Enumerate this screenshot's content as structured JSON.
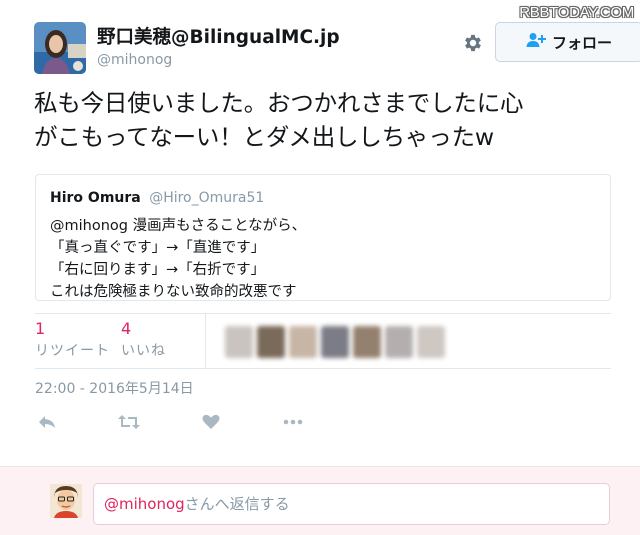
{
  "watermark": "RBBTODAY.COM",
  "author": {
    "display_name": "野口美穂@BilingualMC.jp",
    "handle": "@mihonog"
  },
  "follow_button": {
    "label": "フォロー",
    "icon": "add-user-icon"
  },
  "tweet": {
    "text_line1": "私も今日使いました。おつかれさまでしたに心",
    "text_line2": "がこもってなーい！とダメ出ししちゃったw"
  },
  "quote": {
    "name": "Hiro Omura",
    "handle": "@Hiro_Omura51",
    "mention": "@mihonog",
    "line1_rest": " 漫画声もさることながら、",
    "line2": "「真っ直ぐです」→「直進です」",
    "line3": "「右に回ります」→「右折です」",
    "line4": "これは危険極まりない致命的改悪です"
  },
  "stats": {
    "retweets": {
      "count": "1",
      "label": "リツイート"
    },
    "likes": {
      "count": "4",
      "label": "いいね"
    }
  },
  "timestamp": "22:00 - 2016年5月14日",
  "actions": [
    "reply-icon",
    "retweet-icon",
    "heart-icon",
    "more-icon"
  ],
  "reply": {
    "placeholder_mention": "@mihonog",
    "placeholder_rest": "さんへ返信する"
  },
  "colors": {
    "accent_pink": "#e0245e",
    "muted_text": "#8899a6",
    "border": "#e1e8ed",
    "reply_bg": "#fdf1f4"
  }
}
